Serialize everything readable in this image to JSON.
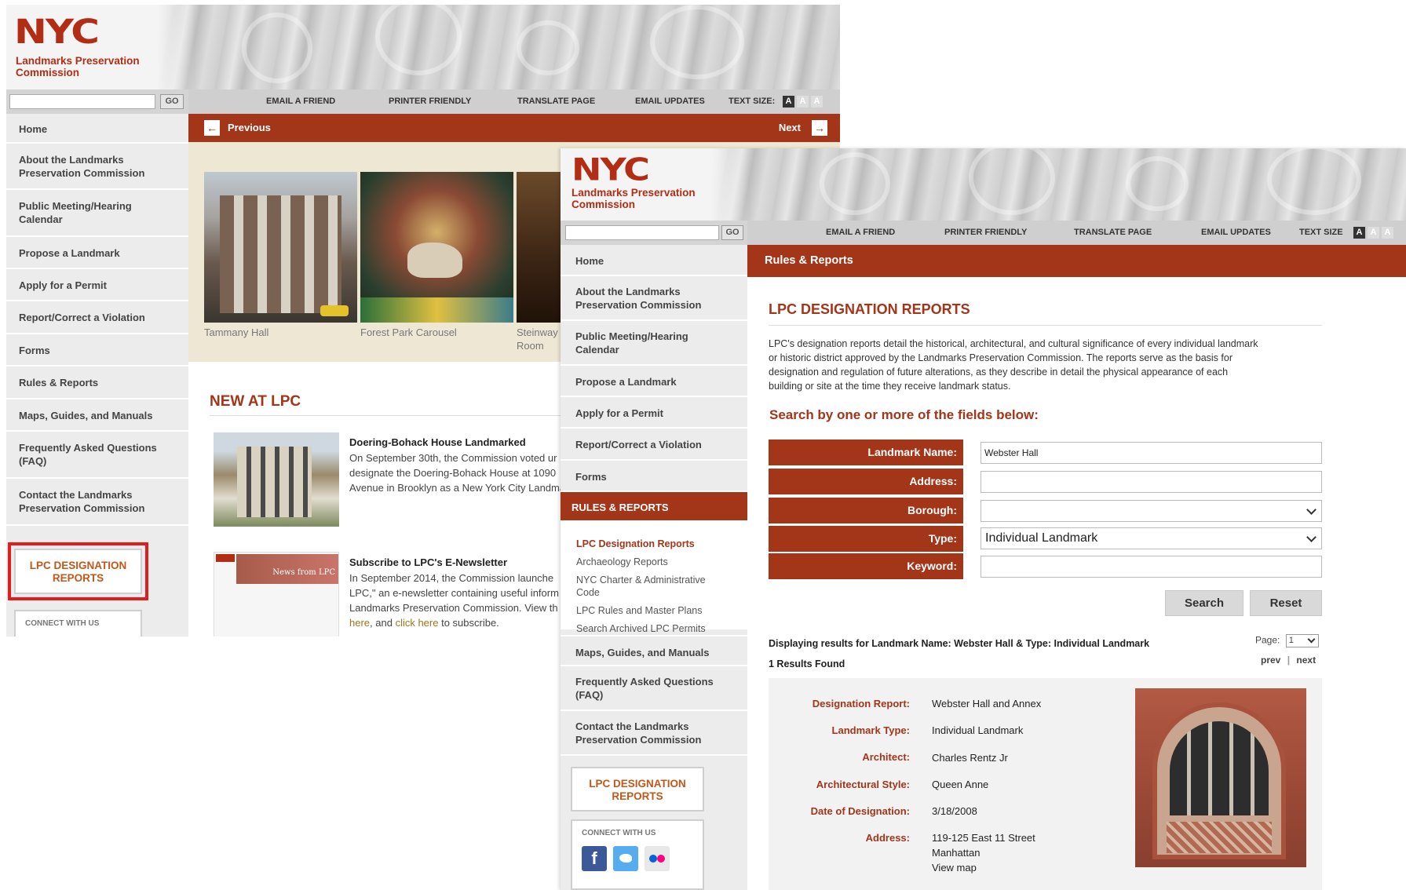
{
  "brand": {
    "logo": "NYC",
    "org_line1": "Landmarks Preservation",
    "org_line2": "Commission",
    "go_label": "GO"
  },
  "toolbar": {
    "email_friend": "EMAIL A FRIEND",
    "printer_friendly": "PRINTER FRIENDLY",
    "translate": "TRANSLATE PAGE",
    "email_updates": "EMAIL UPDATES",
    "text_size_back": "TEXT SIZE:",
    "text_size_front": "TEXT SIZE",
    "size_letter": "A"
  },
  "sidebar": {
    "items": [
      {
        "label": "Home"
      },
      {
        "label": "About the Landmarks Preservation Commission"
      },
      {
        "label": "Public Meeting/Hearing Calendar"
      },
      {
        "label": "Propose a Landmark"
      },
      {
        "label": "Apply for a Permit"
      },
      {
        "label": "Report/Correct a Violation"
      },
      {
        "label": "Forms"
      },
      {
        "label": "Rules & Reports"
      },
      {
        "label": "Maps, Guides, and Manuals"
      },
      {
        "label": "Frequently Asked Questions (FAQ)"
      },
      {
        "label": "Contact the Landmarks Preservation Commission"
      }
    ],
    "active_upper": "RULES & REPORTS",
    "sub_items": [
      "LPC Designation Reports",
      "Archaeology Reports",
      "NYC Charter & Administrative Code",
      "LPC Rules and Master Plans",
      "Search Archived LPC Permits"
    ],
    "badge_line1": "LPC DESIGNATION",
    "badge_line2": "REPORTS",
    "connect": "CONNECT WITH US"
  },
  "window1": {
    "prev": "Previous",
    "next": "Next",
    "captions": [
      "Tammany Hall",
      "Forest Park Carousel",
      "Steinway",
      "Room"
    ],
    "news_heading": "NEW AT LPC",
    "news": [
      {
        "title": "Doering-Bohack House Landmarked",
        "lines": [
          "On September 30th, the Commission voted ur",
          "designate the Doering-Bohack House at 1090",
          "Avenue in Brooklyn as a New York City Landma"
        ]
      },
      {
        "title": "Subscribe to LPC's E-Newsletter",
        "lines": [
          "In September 2014, the Commission launche",
          "LPC,\" an e-newsletter containing useful inform",
          "Landmarks Preservation Commission. View th"
        ],
        "link1": "here",
        "mid": ", and ",
        "link2": "click here",
        "end": " to subscribe."
      }
    ],
    "newsletter_thumb": "News from LPC"
  },
  "window2": {
    "section_bar": "Rules & Reports",
    "page_heading": "LPC DESIGNATION REPORTS",
    "intro_lines": [
      "LPC's designation reports detail the historical, architectural, and cultural significance of every individual landmark",
      "or historic district approved by the Landmarks Preservation Commission. The reports serve as the basis for",
      "designation and regulation of future alterations, as they describe in detail the physical appearance of each",
      "building or site at the time they receive landmark status."
    ],
    "search_heading": "Search by one or more of the fields below:",
    "fields": {
      "landmark_name": {
        "label": "Landmark Name:",
        "value": "Webster Hall"
      },
      "address": {
        "label": "Address:",
        "value": ""
      },
      "borough": {
        "label": "Borough:",
        "value": ""
      },
      "type": {
        "label": "Type:",
        "value": "Individual Landmark"
      },
      "keyword": {
        "label": "Keyword:",
        "value": ""
      }
    },
    "search_btn": "Search",
    "reset_btn": "Reset",
    "results_line": "Displaying results for Landmark Name: Webster Hall & Type: Individual Landmark",
    "results_count": "1 Results Found",
    "page_label": "Page:",
    "page_value": "1",
    "prev": "prev",
    "sep": "|",
    "next": "next",
    "result": {
      "designation_report": {
        "label": "Designation Report:",
        "value": "Webster Hall and Annex"
      },
      "landmark_type": {
        "label": "Landmark Type:",
        "value": "Individual Landmark"
      },
      "architect": {
        "label": "Architect:",
        "value": "Charles Rentz Jr"
      },
      "style": {
        "label": "Architectural Style:",
        "value": "Queen Anne"
      },
      "date": {
        "label": "Date of Designation:",
        "value": "3/18/2008"
      },
      "address": {
        "label": "Address:",
        "line1": "119-125 East 11 Street",
        "line2": "Manhattan",
        "map": "View map"
      }
    }
  },
  "colors": {
    "brand_red": "#a33519",
    "logo_red": "#b32d14",
    "badge_orange": "#c3571a",
    "link_gold": "#a0721b",
    "highlight": "#e11e1e"
  }
}
